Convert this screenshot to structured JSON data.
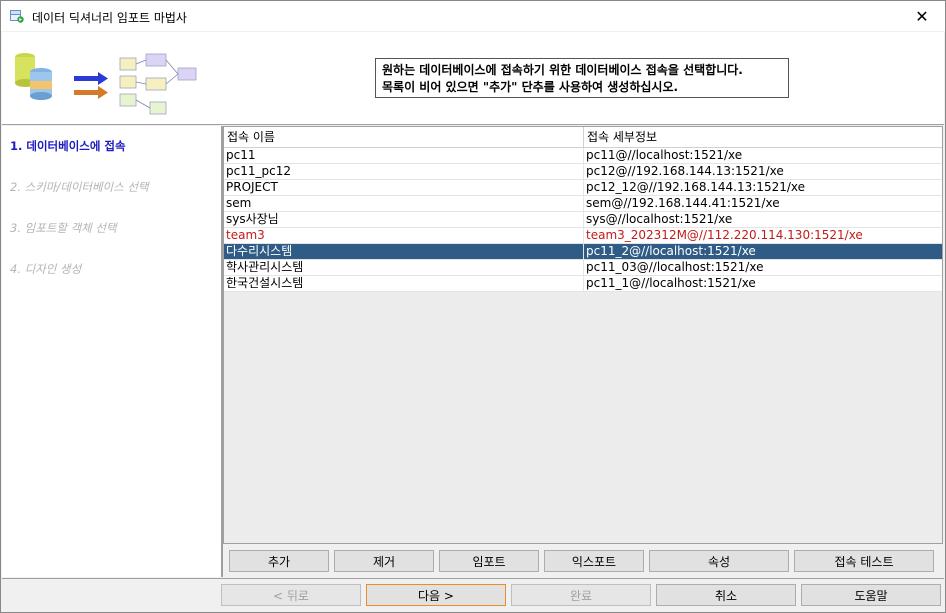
{
  "window": {
    "title": "데이터 딕셔너리 임포트 마법사",
    "close_symbol": "✕"
  },
  "header": {
    "instruction_line1": "원하는 데이터베이스에 접속하기 위한 데이터베이스 접속을 선택합니다.",
    "instruction_line2": "목록이 비어 있으면 \"추가\" 단추를 사용하여 생성하십시오."
  },
  "steps": [
    {
      "label": "1. 데이터베이스에 접속",
      "active": true
    },
    {
      "label": "2. 스키마/데이터베이스 선택",
      "active": false
    },
    {
      "label": "3. 임포트할 객체 선택",
      "active": false
    },
    {
      "label": "4. 디자인 생성",
      "active": false
    }
  ],
  "grid": {
    "columns": [
      "접속 이름",
      "접속 세부정보"
    ],
    "rows": [
      {
        "name": "pc11",
        "detail": "pc11@//localhost:1521/xe",
        "state": "normal"
      },
      {
        "name": "pc11_pc12",
        "detail": "pc12@//192.168.144.13:1521/xe",
        "state": "normal"
      },
      {
        "name": "PROJECT",
        "detail": "pc12_12@//192.168.144.13:1521/xe",
        "state": "normal"
      },
      {
        "name": "sem",
        "detail": "sem@//192.168.144.41:1521/xe",
        "state": "normal"
      },
      {
        "name": "sys사장님",
        "detail": "sys@//localhost:1521/xe",
        "state": "normal"
      },
      {
        "name": "team3",
        "detail": "team3_202312M@//112.220.114.130:1521/xe",
        "state": "red"
      },
      {
        "name": "다수리시스템",
        "detail": "pc11_2@//localhost:1521/xe",
        "state": "selected"
      },
      {
        "name": "학사관리시스템",
        "detail": "pc11_03@//localhost:1521/xe",
        "state": "normal"
      },
      {
        "name": "한국건설시스템",
        "detail": "pc11_1@//localhost:1521/xe",
        "state": "normal"
      }
    ]
  },
  "grid_buttons": {
    "add": "추가",
    "remove": "제거",
    "import": "임포트",
    "export": "익스포트",
    "properties": "속성",
    "test": "접속 테스트"
  },
  "nav_buttons": {
    "back": "< 뒤로",
    "next": "다음 >",
    "finish": "완료",
    "cancel": "취소",
    "help": "도움말"
  },
  "colors": {
    "selected_row": "#2f5c86",
    "error_text": "#c31a1a",
    "active_step": "#1b1bc0"
  }
}
